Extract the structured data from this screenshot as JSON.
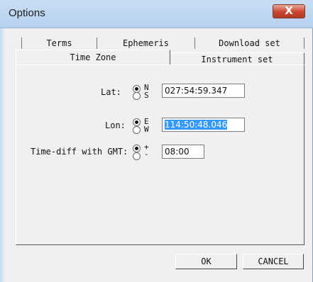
{
  "window": {
    "title": "Options",
    "close_glyph": "X"
  },
  "tabs": {
    "back_row": [
      "Terms",
      "Ephemeris",
      "Download set"
    ],
    "front_row": {
      "active": "Time Zone",
      "other": "Instrument set"
    }
  },
  "lat": {
    "label": "Lat:",
    "options": [
      "N",
      "S"
    ],
    "selected": "N",
    "value": "027:54:59.347"
  },
  "lon": {
    "label": "Lon:",
    "options": [
      "E",
      "W"
    ],
    "selected": "E",
    "value": "114:50:48.046"
  },
  "gmt": {
    "label": "Time-diff with GMT:",
    "options": [
      "+",
      "-"
    ],
    "selected": "+",
    "value": "08:00"
  },
  "buttons": {
    "ok": "OK",
    "cancel": "CANCEL"
  }
}
